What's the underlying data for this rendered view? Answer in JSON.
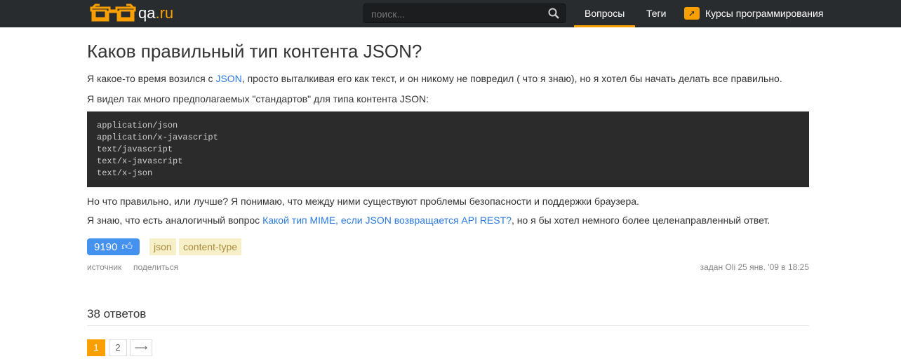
{
  "header": {
    "logo_main": "qa",
    "logo_suffix": ".ru",
    "search_placeholder": "поиск...",
    "nav": [
      "Вопросы",
      "Теги",
      "Курсы программирования"
    ]
  },
  "question": {
    "title": "Каков правильный тип контента JSON?",
    "p1_before": "Я какое-то время возился с ",
    "p1_link": "JSON",
    "p1_after": ", просто выталкивая его как текст, и он никому не повредил ( что я знаю), но я хотел бы начать делать все правильно.",
    "p2": "Я видел так много предполагаемых \"стандартов\" для типа контента JSON:",
    "code": "application/json\napplication/x-javascript\ntext/javascript\ntext/x-javascript\ntext/x-json",
    "p3": "Но что правильно, или лучше? Я понимаю, что между ними существуют проблемы безопасности и поддержки браузера.",
    "p4_before": "Я знаю, что есть аналогичный вопрос ",
    "p4_link": "Какой тип MIME, если JSON возвращается API REST?",
    "p4_after": ", но я бы хотел немного более целенаправленный ответ.",
    "votes": "9190",
    "tags": [
      "json",
      "content-type"
    ],
    "source": "источник",
    "share": "поделиться",
    "asked": "задан Oli 25 янв. '09 в 18:25"
  },
  "answers": {
    "count_label": "38 ответов",
    "pages": [
      "1",
      "2"
    ],
    "next": "⟶"
  }
}
